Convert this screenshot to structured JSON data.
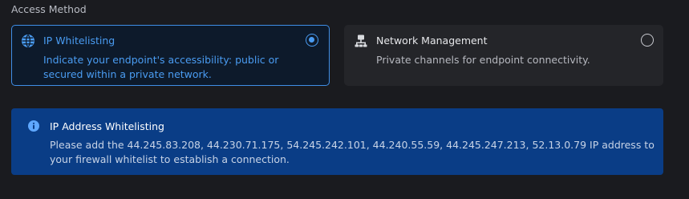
{
  "access_method": {
    "label": "Access Method",
    "options": [
      {
        "title": "IP Whitelisting",
        "description": "Indicate your endpoint's accessibility: public or secured within a private network.",
        "icon": "globe-icon",
        "selected": true
      },
      {
        "title": "Network Management",
        "description": "Private channels for endpoint connectivity.",
        "icon": "network-icon",
        "selected": false
      }
    ]
  },
  "info": {
    "icon": "info-icon",
    "title": "IP Address Whitelisting",
    "text": "Please add the 44.245.83.208, 44.230.71.175, 54.245.242.101, 44.240.55.59, 44.245.247.213, 52.13.0.79 IP address to your firewall whitelist to establish a connection."
  },
  "colors": {
    "accent": "#4a9cf2",
    "info_background": "#0a3d86",
    "page_background": "#1a1b1f"
  }
}
